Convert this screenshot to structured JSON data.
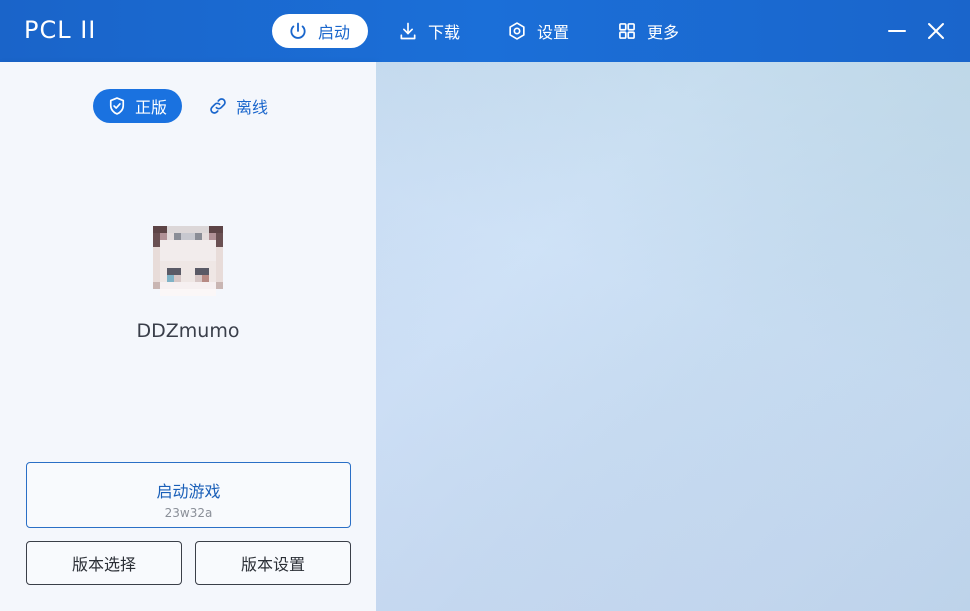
{
  "app": {
    "title": "PCL II"
  },
  "nav": {
    "tabs": [
      {
        "label": "启动",
        "icon": "power-icon",
        "active": true
      },
      {
        "label": "下载",
        "icon": "download-icon",
        "active": false
      },
      {
        "label": "设置",
        "icon": "settings-icon",
        "active": false
      },
      {
        "label": "更多",
        "icon": "grid-icon",
        "active": false
      }
    ]
  },
  "window_controls": {
    "minimize_icon": "minimize-icon",
    "close_icon": "close-icon"
  },
  "account": {
    "modes": [
      {
        "label": "正版",
        "icon": "shield-check-icon",
        "active": true
      },
      {
        "label": "离线",
        "icon": "link-icon",
        "active": false
      }
    ],
    "username": "DDZmumo"
  },
  "launch": {
    "label": "启动游戏",
    "version": "23w32a"
  },
  "version_buttons": {
    "select_label": "版本选择",
    "settings_label": "版本设置"
  },
  "colors": {
    "titlebar": "#1b6fd8",
    "accent": "#1a72e0",
    "panel_bg": "#f4f7fc"
  }
}
